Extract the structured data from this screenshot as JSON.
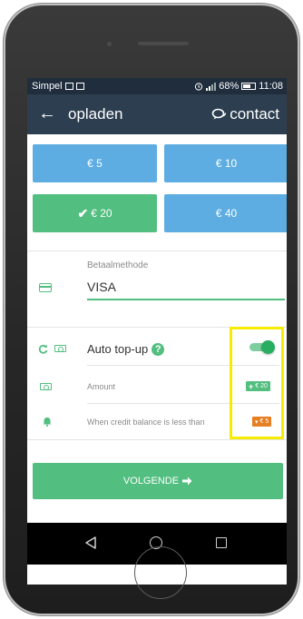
{
  "status_bar": {
    "carrier": "Simpel",
    "battery": "68%",
    "time": "11:08",
    "battery_level": 0.68
  },
  "header": {
    "title": "opladen",
    "contact_label": "contact"
  },
  "amounts": [
    {
      "label": "€ 5",
      "selected": false
    },
    {
      "label": "€ 10",
      "selected": false
    },
    {
      "label": "€ 20",
      "selected": true
    },
    {
      "label": "€ 40",
      "selected": false
    }
  ],
  "payment": {
    "label": "Betaalmethode",
    "value": "VISA"
  },
  "auto_topup": {
    "label": "Auto top-up",
    "help_icon": "question-icon",
    "enabled": true
  },
  "amount_row": {
    "label": "Amount",
    "badge": "€ 20",
    "badge_sign": "+"
  },
  "threshold_row": {
    "label": "When credit balance is less than",
    "badge": "€ 5",
    "badge_sign": "▾"
  },
  "next_button": {
    "label": "VOLGENDE",
    "icon": "arrow-right-icon"
  },
  "colors": {
    "blue": "#5dade2",
    "green": "#52be80",
    "header": "#2c3e50",
    "orange": "#e67e22",
    "highlight": "#f5ec00"
  }
}
